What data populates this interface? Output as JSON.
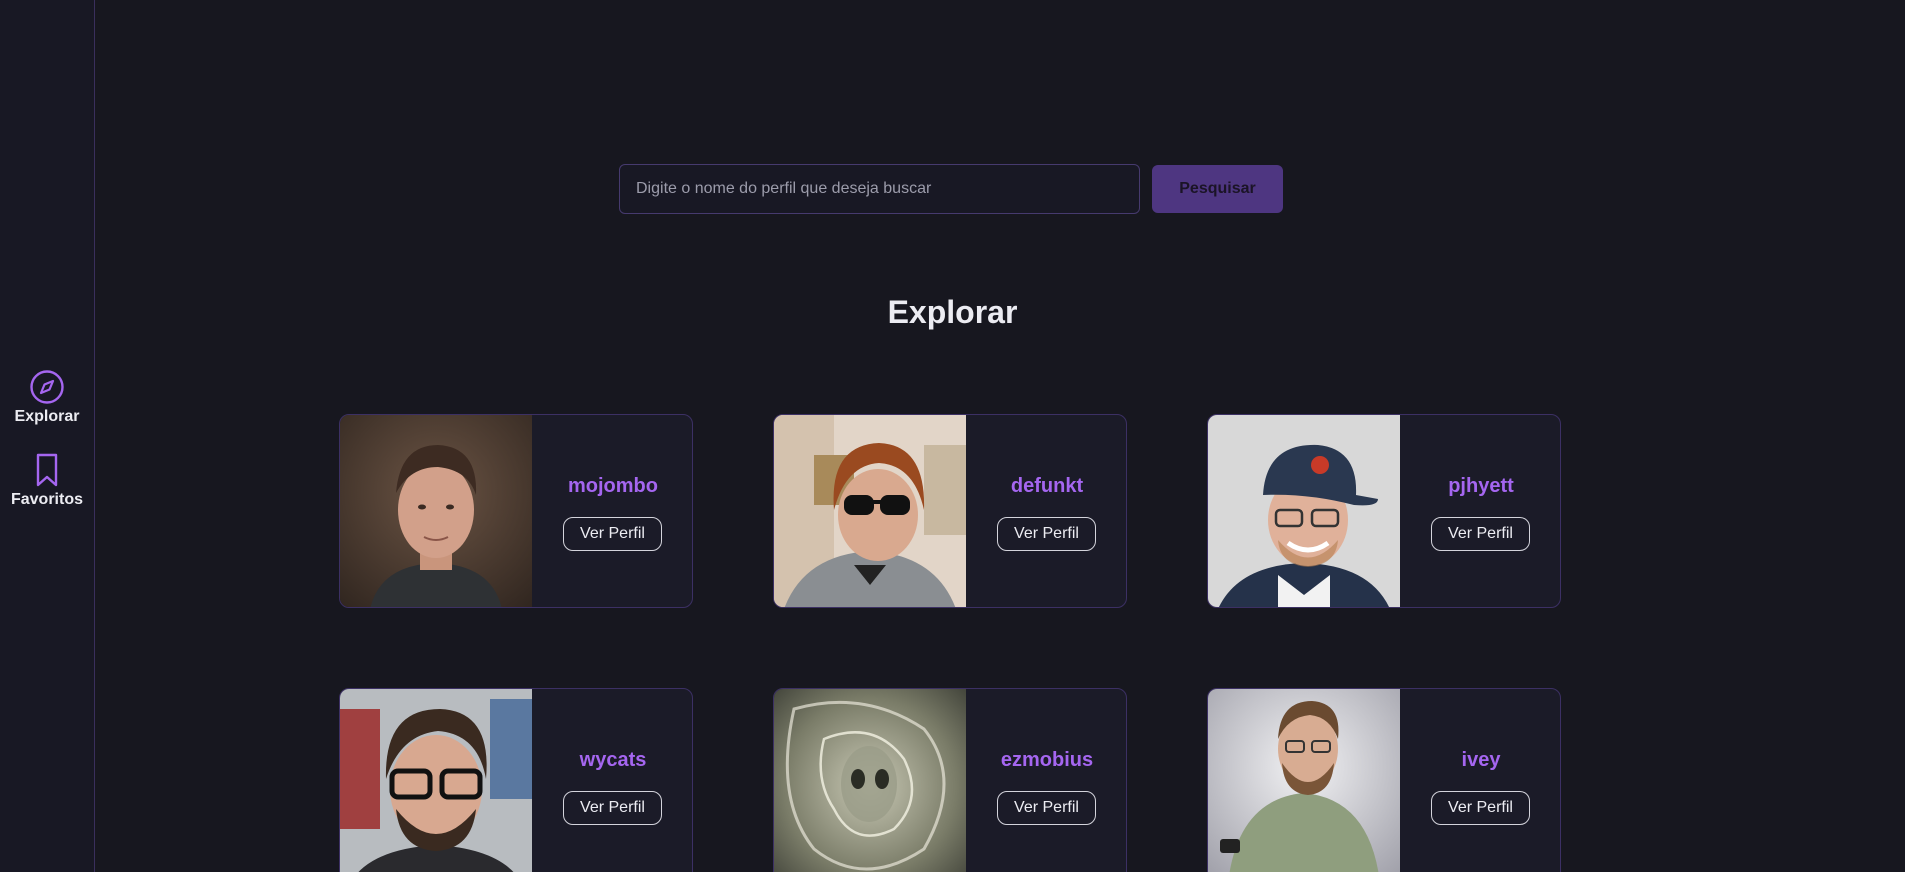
{
  "sidebar": {
    "items": [
      {
        "label": "Explorar",
        "icon": "compass-icon"
      },
      {
        "label": "Favoritos",
        "icon": "bookmark-icon"
      }
    ]
  },
  "search": {
    "placeholder": "Digite o nome do perfil que deseja buscar",
    "value": "",
    "button_label": "Pesquisar"
  },
  "main": {
    "title": "Explorar"
  },
  "profiles": [
    {
      "name": "mojombo",
      "button_label": "Ver Perfil"
    },
    {
      "name": "defunkt",
      "button_label": "Ver Perfil"
    },
    {
      "name": "pjhyett",
      "button_label": "Ver Perfil"
    },
    {
      "name": "wycats",
      "button_label": "Ver Perfil"
    },
    {
      "name": "ezmobius",
      "button_label": "Ver Perfil"
    },
    {
      "name": "ivey",
      "button_label": "Ver Perfil"
    }
  ],
  "colors": {
    "background": "#17171f",
    "accent": "#a566f0",
    "button": "#4e3681",
    "border": "#3c3064"
  }
}
